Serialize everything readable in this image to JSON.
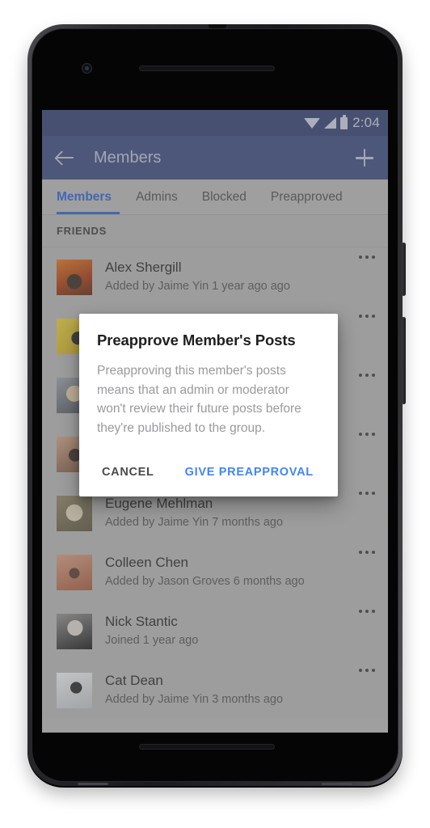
{
  "status_bar": {
    "time": "2:04",
    "icons": [
      "wifi-icon",
      "signal-icon",
      "battery-icon"
    ]
  },
  "app_bar": {
    "back_icon": "back-arrow-icon",
    "title": "Members",
    "add_icon": "plus-icon"
  },
  "tabs": [
    {
      "label": "Members",
      "active": true
    },
    {
      "label": "Admins",
      "active": false
    },
    {
      "label": "Blocked",
      "active": false
    },
    {
      "label": "Preapproved",
      "active": false
    }
  ],
  "section": {
    "header": "FRIENDS"
  },
  "members": [
    {
      "name": "Alex Shergill",
      "meta": "Added by Jaime Yin 1 year ago ago",
      "avatar": "#b8521f"
    },
    {
      "name": "",
      "meta": "",
      "avatar": "#d6c03a"
    },
    {
      "name": "",
      "meta": "",
      "avatar": "#7d7f86"
    },
    {
      "name": "",
      "meta": "",
      "avatar": "#8d6f5c"
    },
    {
      "name": "Eugene Mehlman",
      "meta": "Added by Jaime Yin 7 months ago",
      "avatar": "#8e8569"
    },
    {
      "name": "Colleen Chen",
      "meta": "Added by Jason Groves 6 months ago",
      "avatar": "#c07a63"
    },
    {
      "name": "Nick Stantic",
      "meta": "Joined 1 year ago",
      "avatar": "#6e6e6e"
    },
    {
      "name": "Cat Dean",
      "meta": "Added by Jaime Yin 3 months ago",
      "avatar": "#c9cdd2"
    }
  ],
  "dialog": {
    "title": "Preapprove Member's Posts",
    "body": "Preapproving this member's posts means that an admin or moderator won't review their future posts before they're published to the group.",
    "cancel_label": "CANCEL",
    "confirm_label": "GIVE PREAPPROVAL"
  },
  "colors": {
    "status_bar": "#344072",
    "app_bar": "#3b4a7e",
    "accent_blue": "#2f63cc",
    "dialog_action_blue": "#4285f4",
    "screen_background": "#b2b2b2"
  }
}
